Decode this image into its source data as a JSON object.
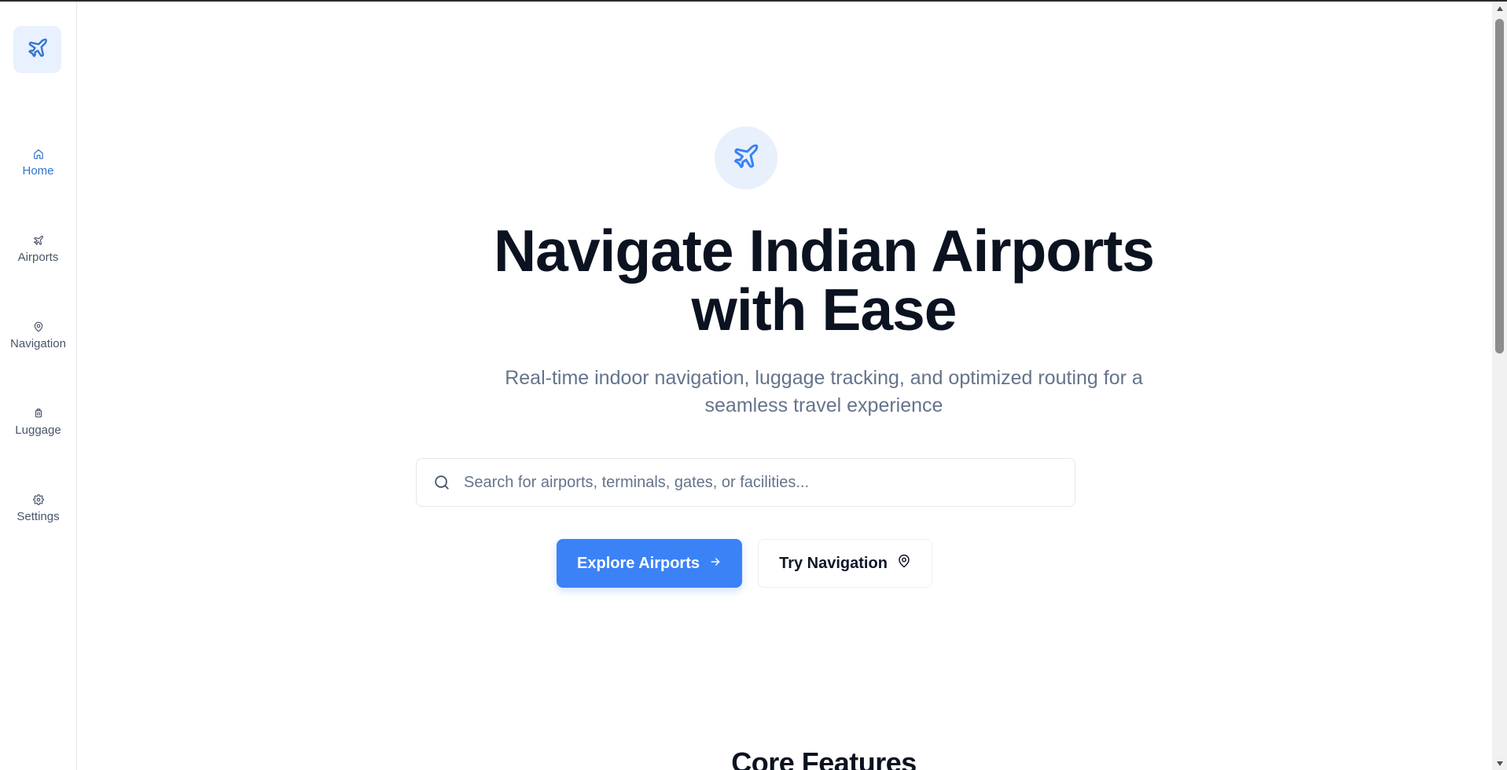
{
  "sidebar": {
    "logo_icon": "plane-icon",
    "items": [
      {
        "label": "Home",
        "icon": "home-icon",
        "active": true
      },
      {
        "label": "Airports",
        "icon": "plane-icon",
        "active": false
      },
      {
        "label": "Navigation",
        "icon": "map-pin-icon",
        "active": false
      },
      {
        "label": "Luggage",
        "icon": "luggage-icon",
        "active": false
      },
      {
        "label": "Settings",
        "icon": "gear-icon",
        "active": false
      }
    ]
  },
  "hero": {
    "icon": "plane-icon",
    "title_line1": "Navigate Indian Airports",
    "title_line2": "with Ease",
    "subtitle_line1": "Real-time indoor navigation, luggage tracking, and optimized routing for a",
    "subtitle_line2": "seamless travel experience"
  },
  "search": {
    "placeholder": "Search for airports, terminals, gates, or facilities...",
    "value": ""
  },
  "actions": {
    "explore_label": "Explore Airports",
    "navigation_label": "Try Navigation"
  },
  "features": {
    "section_title": "Core Features"
  },
  "colors": {
    "accent": "#3b82f6",
    "active_nav": "#2f74d0",
    "icon_bg": "#e8f1fd"
  }
}
